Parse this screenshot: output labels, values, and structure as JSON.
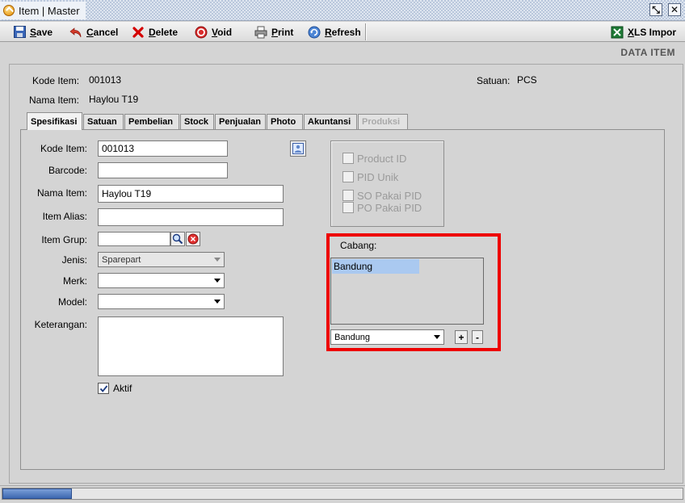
{
  "window": {
    "title": "Item | Master",
    "restore_glyph": "⤡",
    "close_glyph": "✕"
  },
  "toolbar": {
    "save": "Save",
    "cancel": "Cancel",
    "delete": "Delete",
    "void": "Void",
    "print": "Print",
    "refresh": "Refresh",
    "xls_import": "XLS Impor"
  },
  "header": {
    "section_title": "DATA ITEM",
    "kode_item_label": "Kode Item:",
    "kode_item_value": "001013",
    "nama_item_label": "Nama Item:",
    "nama_item_value": "Haylou T19",
    "satuan_label": "Satuan:",
    "satuan_value": "PCS"
  },
  "tabs": {
    "spesifikasi": "Spesifikasi",
    "satuan": "Satuan",
    "pembelian": "Pembelian",
    "stock": "Stock",
    "penjualan": "Penjualan",
    "photo": "Photo",
    "akuntansi": "Akuntansi",
    "produksi": "Produksi"
  },
  "form": {
    "kode_item_label": "Kode Item:",
    "kode_item_value": "001013",
    "barcode_label": "Barcode:",
    "barcode_value": "",
    "nama_item_label": "Nama Item:",
    "nama_item_value": "Haylou T19",
    "item_alias_label": "Item Alias:",
    "item_alias_value": "",
    "item_grup_label": "Item Grup:",
    "item_grup_value": "",
    "jenis_label": "Jenis:",
    "jenis_value": "Sparepart",
    "merk_label": "Merk:",
    "merk_value": "",
    "model_label": "Model:",
    "model_value": "",
    "keterangan_label": "Keterangan:",
    "keterangan_value": "",
    "aktif_label": "Aktif",
    "aktif_checked": true
  },
  "pid_options": {
    "product_id": "Product ID",
    "pid_unik": "PID Unik",
    "so_pakai_pid": "SO Pakai PID",
    "po_pakai_pid": "PO Pakai PID"
  },
  "cabang": {
    "label": "Cabang:",
    "list_items": [
      "Bandung"
    ],
    "selected_value": "Bandung",
    "add_label": "+",
    "remove_label": "-"
  },
  "colors": {
    "highlight_border": "#ee0000",
    "list_selection": "#aac9f0",
    "delete_icon": "#d40000",
    "scroll_thumb": "#3d68b0"
  }
}
